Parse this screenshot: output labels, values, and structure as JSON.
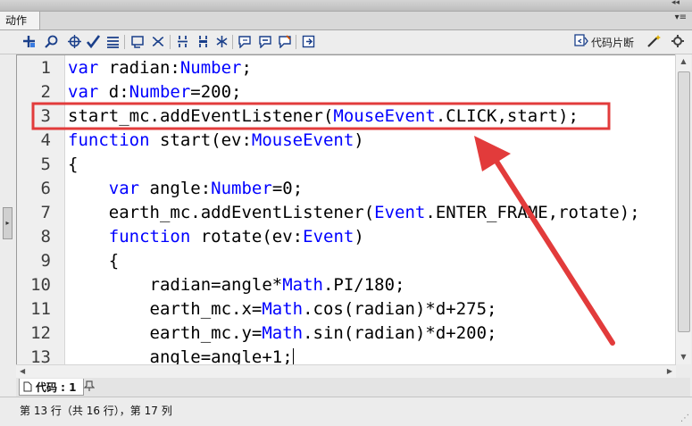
{
  "panel": {
    "tab_label": "动作",
    "collapse_glyph": "◂◂",
    "close_glyph": "✕",
    "menu_glyph": "▾≡"
  },
  "toolbar": {
    "icons": [
      "add-item-icon",
      "find-icon",
      "target-icon",
      "check-syntax-icon",
      "auto-format-icon",
      "code-hint-icon",
      "debug-options-icon",
      "collapse-braces-icon",
      "collapse-selection-icon",
      "expand-all-icon",
      "apply-block-comment-icon",
      "apply-line-comment-icon",
      "remove-comment-icon",
      "toggle-script-assist-icon"
    ],
    "snippets_label": "代码片断"
  },
  "editor": {
    "lines": [
      {
        "num": "1",
        "code": "var radian:Number;"
      },
      {
        "num": "2",
        "code": "var d:Number=200;"
      },
      {
        "num": "3",
        "code": "start_mc.addEventListener(MouseEvent.CLICK,start);"
      },
      {
        "num": "4",
        "code": "function start(ev:MouseEvent)"
      },
      {
        "num": "5",
        "code": "{"
      },
      {
        "num": "6",
        "code": "    var angle:Number=0;"
      },
      {
        "num": "7",
        "code": "    earth_mc.addEventListener(Event.ENTER_FRAME,rotate);"
      },
      {
        "num": "8",
        "code": "    function rotate(ev:Event)"
      },
      {
        "num": "9",
        "code": "    {"
      },
      {
        "num": "10",
        "code": "        radian=angle*Math.PI/180;"
      },
      {
        "num": "11",
        "code": "        earth_mc.x=Math.cos(radian)*d+275;"
      },
      {
        "num": "12",
        "code": "        earth_mc.y=Math.sin(radian)*d+200;"
      },
      {
        "num": "13",
        "code": "        angle=angle+1;"
      }
    ],
    "highlight_line": 3,
    "highlight_color": "#e23b3b"
  },
  "bottom_tab": {
    "label": "代码 : 1"
  },
  "status": {
    "text": "第 13 行（共 16 行），第 17 列"
  }
}
